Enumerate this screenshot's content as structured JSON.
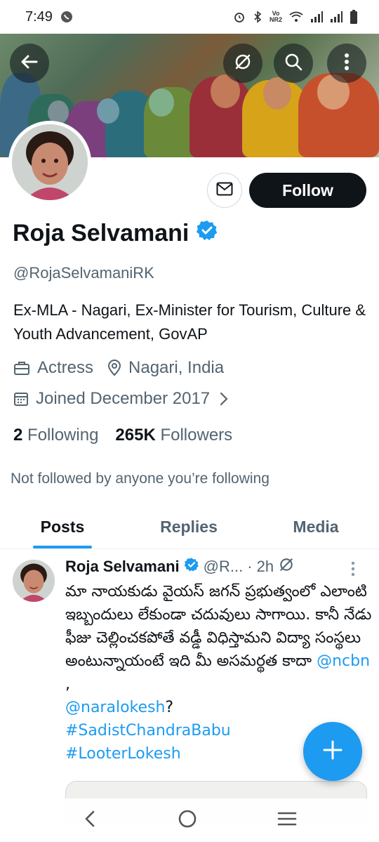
{
  "status_bar": {
    "time": "7:49",
    "icons": [
      "whatsapp-icon",
      "alarm-icon",
      "bluetooth-icon",
      "volte-icon",
      "wifi-icon",
      "signal-icon",
      "signal-icon",
      "battery-icon"
    ],
    "volte_top": "Vo",
    "volte_bottom": "NR2"
  },
  "top_bar": {
    "back_icon": "back-arrow-icon",
    "grok_icon": "grok-icon",
    "search_icon": "search-icon",
    "more_icon": "more-vertical-icon"
  },
  "profile": {
    "display_name": "Roja Selvamani",
    "verified": true,
    "handle": "@RojaSelvamaniRK",
    "bio": "Ex-MLA - Nagari, Ex-Minister for Tourism, Culture & Youth Advancement, GovAP",
    "profession": "Actress",
    "location": "Nagari, India",
    "joined": "Joined December 2017",
    "following_count": "2",
    "following_label": "Following",
    "followers_count": "265K",
    "followers_label": "Followers",
    "not_followed_text": "Not followed by anyone you’re following",
    "follow_button": "Follow"
  },
  "tabs": [
    {
      "label": "Posts",
      "active": true
    },
    {
      "label": "Replies",
      "active": false
    },
    {
      "label": "Media",
      "active": false
    }
  ],
  "post": {
    "author": "Roja Selvamani",
    "handle_truncated": "@R...",
    "time": "· 2h",
    "text": "మా నాయకుడు వైయస్ జగన్ ప్రభుత్వంలో ఎలాంటి ఇబ్బందులు లేకుండా చదువులు సాగాయి. కానీ నేడు ఫీజు చెల్లించకపోతే వడ్డీ విధిస్తామని విద్యా సంస్థలు అంటున్నాయంటే ఇది మీ అసమర్థత కాదా ",
    "mention1": "@ncbn",
    "separator": " ,",
    "mention2": "@naralokesh",
    "question": "?",
    "hashtag1": "#SadistChandraBabu",
    "hashtag2": "#LooterLokesh"
  },
  "colors": {
    "accent": "#1d9bf0",
    "text_primary": "#0f1419",
    "text_secondary": "#536471",
    "follow_button_bg": "#0f1419"
  }
}
